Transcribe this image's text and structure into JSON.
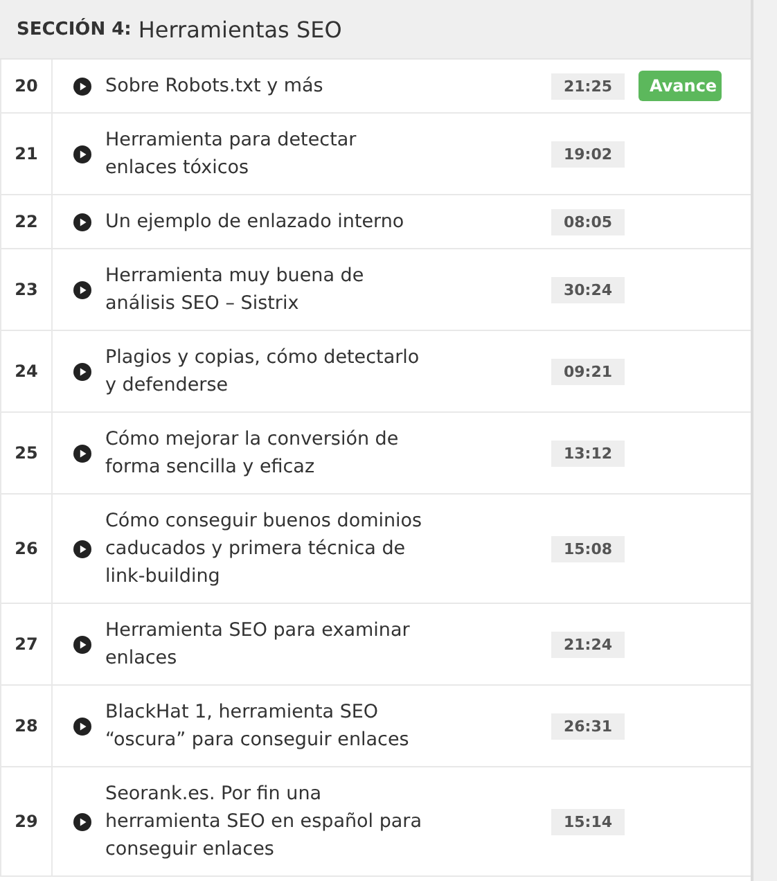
{
  "section": {
    "label": "SECCIÓN 4:",
    "title": "Herramientas SEO"
  },
  "lectures": [
    {
      "number": "20",
      "title": "Sobre Robots.txt y más",
      "duration": "21:25",
      "preview": "Avance"
    },
    {
      "number": "21",
      "title": "Herramienta para detectar enlaces tóxicos",
      "duration": "19:02"
    },
    {
      "number": "22",
      "title": "Un ejemplo de enlazado interno",
      "duration": "08:05"
    },
    {
      "number": "23",
      "title": "Herramienta muy buena de análisis SEO – Sistrix",
      "duration": "30:24"
    },
    {
      "number": "24",
      "title": "Plagios y copias, cómo detectarlo y defenderse",
      "duration": "09:21"
    },
    {
      "number": "25",
      "title": "Cómo mejorar la conversión de forma sencilla y eficaz",
      "duration": "13:12"
    },
    {
      "number": "26",
      "title": "Cómo conseguir buenos dominios caducados y primera técnica de link-building",
      "duration": "15:08"
    },
    {
      "number": "27",
      "title": "Herramienta SEO para examinar enlaces",
      "duration": "21:24"
    },
    {
      "number": "28",
      "title": "BlackHat 1, herramienta SEO “oscura” para conseguir enlaces",
      "duration": "26:31"
    },
    {
      "number": "29",
      "title": "Seorank.es. Por fin una herramienta SEO en español para conseguir enlaces",
      "duration": "15:14"
    }
  ]
}
